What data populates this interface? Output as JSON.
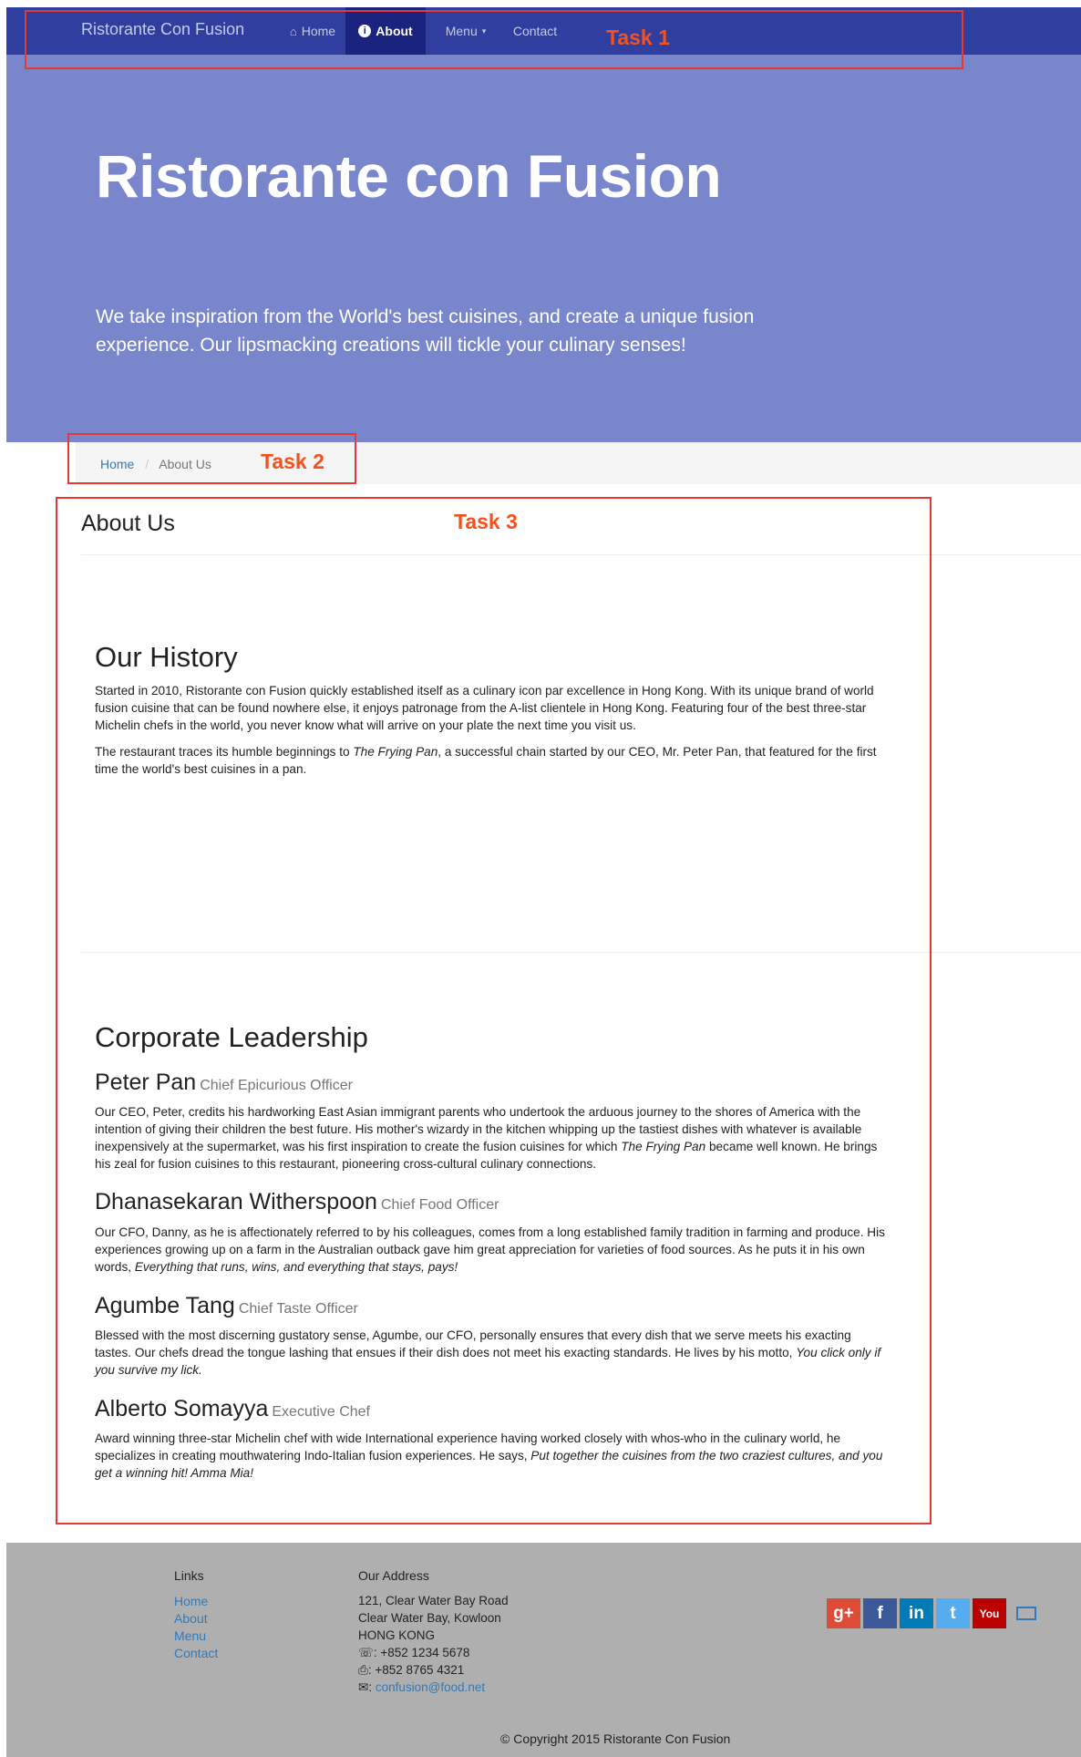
{
  "nav": {
    "brand": "Ristorante Con Fusion",
    "items": [
      {
        "label": "Home",
        "icon": "home-icon"
      },
      {
        "label": "About",
        "icon": "info-icon",
        "active": true
      },
      {
        "label": "Menu",
        "icon": "chevron-down-icon"
      },
      {
        "label": "Contact",
        "icon": ""
      }
    ],
    "colors": {
      "navbar": "#303f9f",
      "active": "#1a237e"
    }
  },
  "tasks": [
    "Task 1",
    "Task 2",
    "Task 3"
  ],
  "jumbotron": {
    "title": "Ristorante con Fusion",
    "text": "We take inspiration from the World's best cuisines, and create a unique fusion experience. Our lipsmacking creations will tickle your culinary senses!",
    "color": "#7986cb"
  },
  "breadcrumb": {
    "home": "Home",
    "separator": "/",
    "current": "About Us"
  },
  "about": {
    "title": "About Us",
    "history": {
      "title": "Our History",
      "p1": "Started in 2010, Ristorante con Fusion quickly established itself as a culinary icon par excellence in Hong Kong. With its unique brand of world fusion cuisine that can be found nowhere else, it enjoys patronage from the A-list clientele in Hong Kong. Featuring four of the best three-star Michelin chefs in the world, you never know what will arrive on your plate the next time you visit us.",
      "p2_a": "The restaurant traces its humble beginnings to ",
      "p2_italic": "The Frying Pan",
      "p2_b": ", a successful chain started by our CEO, Mr. Peter Pan, that featured for the first time the world's best cuisines in a pan."
    },
    "leadership": {
      "title": "Corporate Leadership",
      "leaders": [
        {
          "name": "Peter Pan",
          "role": "Chief Epicurious Officer",
          "desc_a": "Our CEO, Peter, credits his hardworking East Asian immigrant parents who undertook the arduous journey to the shores of America with the intention of giving their children the best future. His mother's wizardy in the kitchen whipping up the tastiest dishes with whatever is available inexpensively at the supermarket, was his first inspiration to create the fusion cuisines for which ",
          "desc_italic": "The Frying Pan",
          "desc_b": " became well known. He brings his zeal for fusion cuisines to this restaurant, pioneering cross-cultural culinary connections."
        },
        {
          "name": "Dhanasekaran Witherspoon",
          "role": "Chief Food Officer",
          "desc_a": "Our CFO, Danny, as he is affectionately referred to by his colleagues, comes from a long established family tradition in farming and produce. His experiences growing up on a farm in the Australian outback gave him great appreciation for varieties of food sources. As he puts it in his own words, ",
          "desc_italic": "Everything that runs, wins, and everything that stays, pays!",
          "desc_b": ""
        },
        {
          "name": "Agumbe Tang",
          "role": "Chief Taste Officer",
          "desc_a": "Blessed with the most discerning gustatory sense, Agumbe, our CFO, personally ensures that every dish that we serve meets his exacting tastes. Our chefs dread the tongue lashing that ensues if their dish does not meet his exacting standards. He lives by his motto, ",
          "desc_italic": "You click only if you survive my lick.",
          "desc_b": ""
        },
        {
          "name": "Alberto Somayya",
          "role": "Executive Chef",
          "desc_a": "Award winning three-star Michelin chef with wide International experience having worked closely with whos-who in the culinary world, he specializes in creating mouthwatering Indo-Italian fusion experiences. He says, ",
          "desc_italic": "Put together the cuisines from the two craziest cultures, and you get a winning hit! Amma Mia!",
          "desc_b": ""
        }
      ]
    }
  },
  "footer": {
    "links_title": "Links",
    "links": [
      "Home",
      "About",
      "Menu",
      "Contact"
    ],
    "address_title": "Our Address",
    "address": [
      "121, Clear Water Bay Road",
      "Clear Water Bay, Kowloon",
      "HONG KONG"
    ],
    "phone": ": +852 1234 5678",
    "fax": ": +852 8765 4321",
    "email": "confusion@food.net",
    "social": [
      {
        "icon": "google-plus-icon",
        "glyph": "g+",
        "color": "#dd4b39"
      },
      {
        "icon": "facebook-icon",
        "glyph": "f",
        "color": "#3b5998"
      },
      {
        "icon": "linkedin-icon",
        "glyph": "in",
        "color": "#007bb6"
      },
      {
        "icon": "twitter-icon",
        "glyph": "t",
        "color": "#55acee"
      },
      {
        "icon": "youtube-icon",
        "glyph": "You",
        "color": "#bb0000"
      }
    ],
    "copyright": "© Copyright 2015 Ristorante Con Fusion",
    "background": "#afafaf"
  }
}
